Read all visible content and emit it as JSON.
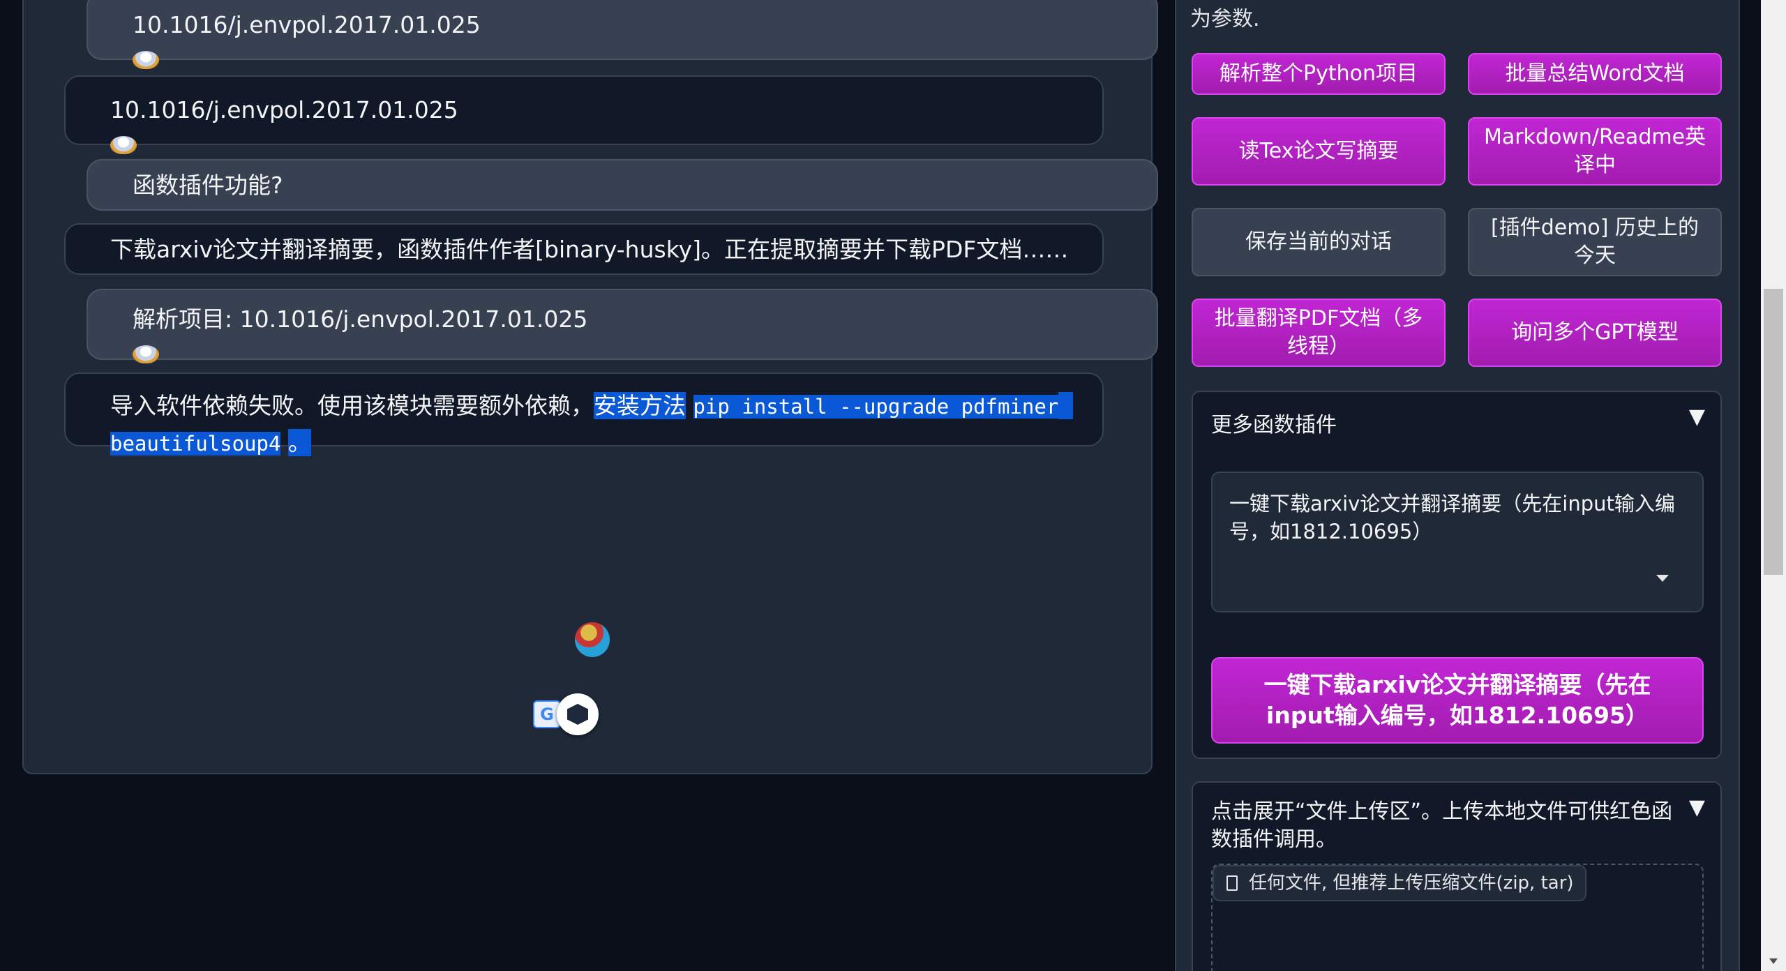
{
  "chat": {
    "messages": [
      {
        "role": "user",
        "text": "10.1016/j.envpol.2017.01.025"
      },
      {
        "role": "bot",
        "text": "10.1016/j.envpol.2017.01.025"
      },
      {
        "role": "user",
        "text": "函数插件功能?"
      },
      {
        "role": "bot",
        "text": "下载arxiv论文并翻译摘要，函数插件作者[binary-husky]。正在提取摘要并下载PDF文档……"
      },
      {
        "role": "user",
        "text": "解析项目: 10.1016/j.envpol.2017.01.025"
      },
      {
        "role": "bot",
        "text_a": "导入软件依赖失败。使用该模块需要额外依赖，",
        "text_b": "安装方法",
        "code_a": "pip install --upgrade pdfminer",
        "code_b": "beautifulsoup4",
        "text_c": "。"
      }
    ]
  },
  "sidebar": {
    "hint": "为参数.",
    "buttons": [
      {
        "label": "解析整个Python项目",
        "style": "purple"
      },
      {
        "label": "批量总结Word文档",
        "style": "purple"
      },
      {
        "label": "读Tex论文写摘要",
        "style": "purple"
      },
      {
        "label": "Markdown/Readme英译中",
        "style": "purple"
      },
      {
        "label": "保存当前的对话",
        "style": "gray"
      },
      {
        "label": "[插件demo] 历史上的今天",
        "style": "gray"
      },
      {
        "label": "批量翻译PDF文档（多线程）",
        "style": "purple"
      },
      {
        "label": "询问多个GPT模型",
        "style": "purple"
      }
    ],
    "more_plugins": {
      "title": "更多函数插件",
      "arrow": "▼",
      "selected": "一键下载arxiv论文并翻译摘要（先在input输入编号，如1812.10695）",
      "run_button": "一键下载arxiv论文并翻译摘要（先在input输入编号，如1812.10695）"
    },
    "upload": {
      "title": "点击展开“文件上传区”。上传本地文件可供红色函数插件调用。",
      "arrow": "▼",
      "file_hint": "任何文件, 但推荐上传压缩文件(zip, tar)"
    }
  },
  "colors": {
    "background": "#0b0f19",
    "panel": "#1f2937",
    "accent_purple": "#c026d3",
    "selection": "#0b58d6"
  }
}
